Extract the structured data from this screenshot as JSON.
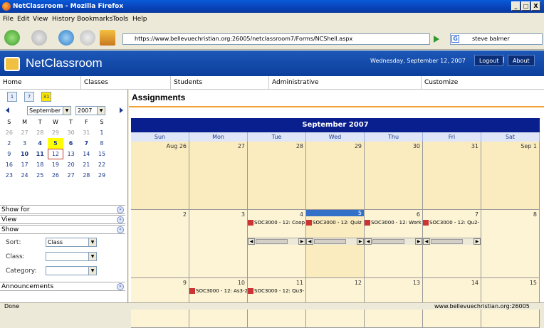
{
  "window": {
    "title": "NetClassroom - Mozilla Firefox",
    "controls": [
      "_",
      "□",
      "X"
    ]
  },
  "menu": [
    "File",
    "Edit",
    "View",
    "History",
    "Bookmarks",
    "Tools",
    "Help"
  ],
  "nav": {
    "url": "https://www.bellevuechristian.org:26005/netclassroom7/Forms/NCShell.aspx",
    "search_value": "steve balmer"
  },
  "app": {
    "title": "NetClassroom",
    "date": "Wednesday, September 12, 2007",
    "logout": "Logout",
    "separator": "|",
    "about": "About"
  },
  "topnav": [
    "Home",
    "Classes",
    "Students",
    "Administrative",
    "Customize"
  ],
  "minical": {
    "view_icons": [
      "1",
      "7",
      "31"
    ],
    "month": "September",
    "year": "2007",
    "dow": [
      "S",
      "M",
      "T",
      "W",
      "T",
      "F",
      "S"
    ],
    "weeks": [
      [
        {
          "d": "26",
          "c": "grey"
        },
        {
          "d": "27",
          "c": "grey"
        },
        {
          "d": "28",
          "c": "grey"
        },
        {
          "d": "29",
          "c": "grey"
        },
        {
          "d": "30",
          "c": "grey"
        },
        {
          "d": "31",
          "c": "grey"
        },
        {
          "d": "1",
          "c": ""
        }
      ],
      [
        {
          "d": "2",
          "c": ""
        },
        {
          "d": "3",
          "c": ""
        },
        {
          "d": "4",
          "c": "bold"
        },
        {
          "d": "5",
          "c": "today"
        },
        {
          "d": "6",
          "c": "bold"
        },
        {
          "d": "7",
          "c": "bold"
        },
        {
          "d": "8",
          "c": ""
        }
      ],
      [
        {
          "d": "9",
          "c": ""
        },
        {
          "d": "10",
          "c": "bold"
        },
        {
          "d": "11",
          "c": "bold"
        },
        {
          "d": "12",
          "c": "sel"
        },
        {
          "d": "13",
          "c": ""
        },
        {
          "d": "14",
          "c": ""
        },
        {
          "d": "15",
          "c": ""
        }
      ],
      [
        {
          "d": "16",
          "c": ""
        },
        {
          "d": "17",
          "c": ""
        },
        {
          "d": "18",
          "c": ""
        },
        {
          "d": "19",
          "c": ""
        },
        {
          "d": "20",
          "c": ""
        },
        {
          "d": "21",
          "c": ""
        },
        {
          "d": "22",
          "c": ""
        }
      ],
      [
        {
          "d": "23",
          "c": ""
        },
        {
          "d": "24",
          "c": ""
        },
        {
          "d": "25",
          "c": ""
        },
        {
          "d": "26",
          "c": ""
        },
        {
          "d": "27",
          "c": ""
        },
        {
          "d": "28",
          "c": ""
        },
        {
          "d": "29",
          "c": ""
        }
      ]
    ]
  },
  "filters": {
    "show_for": "Show for",
    "view": "View",
    "show": "Show",
    "sort_label": "Sort:",
    "sort_value": "Class",
    "class_label": "Class:",
    "class_value": "",
    "category_label": "Category:",
    "category_value": "",
    "announcements": "Announcements"
  },
  "main": {
    "title": "Assignments",
    "month_header": "September 2007",
    "dow": [
      "Sun",
      "Mon",
      "Tue",
      "Wed",
      "Thu",
      "Fri",
      "Sat"
    ],
    "weeks": [
      {
        "days": [
          "Aug 26",
          "27",
          "28",
          "29",
          "30",
          "31",
          "Sep 1"
        ],
        "events": {},
        "scroll": false
      },
      {
        "days": [
          "2",
          "3",
          "4",
          "5",
          "6",
          "7",
          "8"
        ],
        "events": {
          "2": "SOC3000 - 12: Coop",
          "3": "SOC3000 - 12: Quiz",
          "4": "SOC3000 - 12: Work",
          "5": "SOC3000 - 12: Qu2-"
        },
        "scroll": true
      },
      {
        "days": [
          "9",
          "10",
          "11",
          "12",
          "13",
          "14",
          "15"
        ],
        "events": {
          "1": "SOC3000 - 12: As3-2",
          "2": "SOC3000 - 12: Qu3-"
        },
        "scroll": false
      }
    ]
  },
  "status": {
    "left": "Done",
    "right": "www.bellevuechristian.org:26005"
  }
}
